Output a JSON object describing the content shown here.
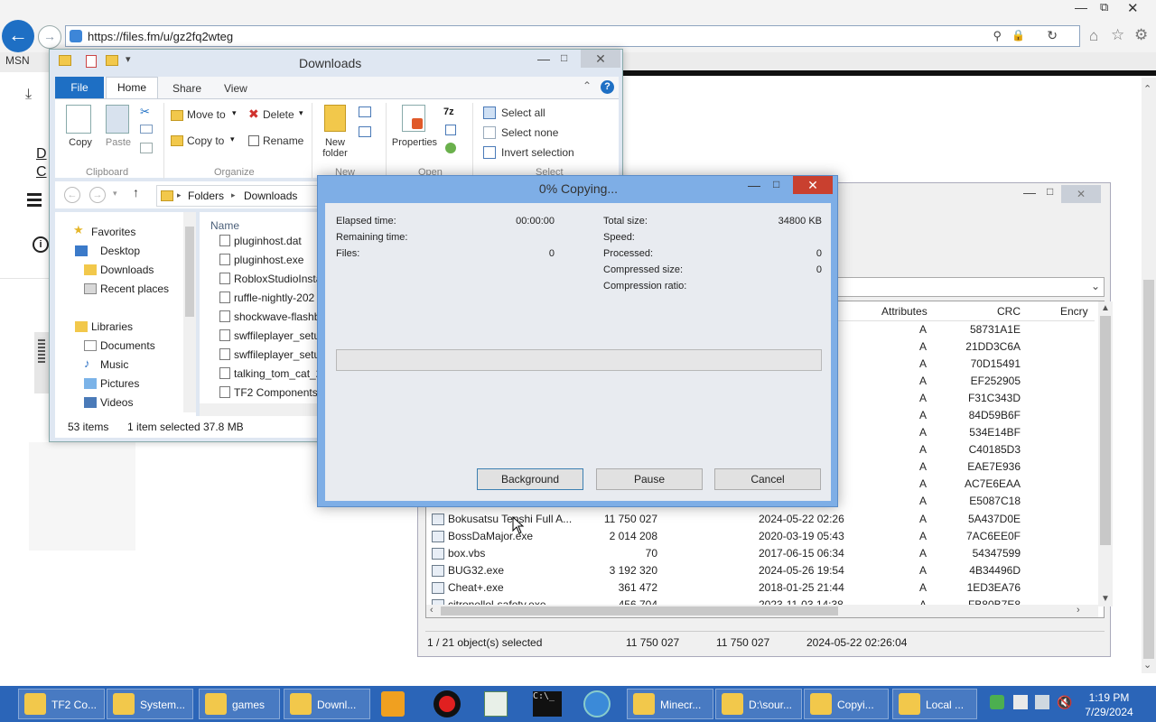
{
  "browser": {
    "url": "https://files.fm/u/gz2fq2wteg",
    "tab_label": "MSN"
  },
  "page": {
    "fragment_letters": [
      "D",
      "C"
    ]
  },
  "explorer": {
    "title": "Downloads",
    "tabs": [
      "File",
      "Home",
      "Share",
      "View"
    ],
    "ribbon": {
      "copy": "Copy",
      "paste": "Paste",
      "move_to": "Move to",
      "copy_to": "Copy to",
      "delete": "Delete",
      "rename": "Rename",
      "new_folder_1": "New",
      "new_folder_2": "folder",
      "properties": "Properties",
      "select_all": "Select all",
      "select_none": "Select none",
      "invert_selection": "Invert selection",
      "groups": {
        "clipboard": "Clipboard",
        "organize": "Organize",
        "new": "New",
        "open": "Open",
        "select": "Select"
      }
    },
    "breadcrumb": [
      "Folders",
      "Downloads"
    ],
    "tree": {
      "favorites": "Favorites",
      "desktop": "Desktop",
      "downloads": "Downloads",
      "recent": "Recent places",
      "libraries": "Libraries",
      "documents": "Documents",
      "music": "Music",
      "pictures": "Pictures",
      "videos": "Videos"
    },
    "column_name": "Name",
    "files": [
      "pluginhost.dat",
      "pluginhost.exe",
      "RobloxStudioInsta",
      "ruffle-nightly-202",
      "shockwave-flashb",
      "swffileplayer_setu",
      "swffileplayer_setu",
      "talking_tom_cat_2",
      "TF2 Components."
    ],
    "status": {
      "items": "53 items",
      "selected": "1 item selected",
      "size": "37.8 MB"
    }
  },
  "archive_window": {
    "columns": {
      "attributes": "Attributes",
      "crc": "CRC",
      "encrypted": "Encry"
    },
    "rows_hidden": [
      {
        "attr": "A",
        "crc": "58731A1E"
      },
      {
        "attr": "A",
        "crc": "21DD3C6A"
      },
      {
        "attr": "A",
        "crc": "70D15491"
      },
      {
        "attr": "A",
        "crc": "EF252905"
      },
      {
        "attr": "A",
        "crc": "F31C343D"
      },
      {
        "attr": "A",
        "crc": "84D59B6F"
      },
      {
        "attr": "A",
        "crc": "534E14BF"
      },
      {
        "attr": "A",
        "crc": "C40185D3"
      },
      {
        "attr": "A",
        "crc": "EAE7E936"
      },
      {
        "attr": "A",
        "crc": "AC7E6EAA"
      },
      {
        "attr": "A",
        "crc": "E5087C18"
      }
    ],
    "rows": [
      {
        "name": "Bokusatsu Tenshi Full A...",
        "size": "11 750 027",
        "date": "2024-05-22 02:26",
        "attr": "A",
        "crc": "5A437D0E"
      },
      {
        "name": "BossDaMajor.exe",
        "size": "2 014 208",
        "date": "2020-03-19 05:43",
        "attr": "A",
        "crc": "7AC6EE0F"
      },
      {
        "name": "box.vbs",
        "size": "70",
        "date": "2017-06-15 06:34",
        "attr": "A",
        "crc": "54347599"
      },
      {
        "name": "BUG32.exe",
        "size": "3 192 320",
        "date": "2024-05-26 19:54",
        "attr": "A",
        "crc": "4B34496D"
      },
      {
        "name": "Cheat+.exe",
        "size": "361 472",
        "date": "2018-01-25 21:44",
        "attr": "A",
        "crc": "1ED3EA76"
      },
      {
        "name": "citronellol-safety.exe",
        "size": "456 704",
        "date": "2023-11-03 14:38",
        "attr": "A",
        "crc": "FB80B7E8"
      }
    ],
    "status": {
      "selected": "1 / 21 object(s) selected",
      "size1": "11 750 027",
      "size2": "11 750 027",
      "date": "2024-05-22 02:26:04"
    }
  },
  "copy_dialog": {
    "title": "0% Copying...",
    "progress_percent": 0,
    "labels": {
      "elapsed": "Elapsed time:",
      "remaining": "Remaining time:",
      "files": "Files:",
      "total_size": "Total size:",
      "speed": "Speed:",
      "processed": "Processed:",
      "compressed": "Compressed size:",
      "ratio": "Compression ratio:"
    },
    "values": {
      "elapsed": "00:00:00",
      "files": "0",
      "total_size": "34800 KB",
      "processed": "0",
      "compressed": "0"
    },
    "buttons": {
      "background": "Background",
      "pause": "Pause",
      "cancel": "Cancel"
    }
  },
  "taskbar": {
    "items": [
      {
        "label": "TF2 Co...",
        "icon": "ie-icon"
      },
      {
        "label": "System...",
        "icon": "folder-icon"
      },
      {
        "label": "games",
        "icon": "folder-icon"
      },
      {
        "label": "Downl...",
        "icon": "folder-icon"
      },
      {
        "label": "Minecr...",
        "icon": "minecraft-icon"
      },
      {
        "label": "D:\\sour...",
        "icon": "7zip-icon"
      },
      {
        "label": "Copyi...",
        "icon": "7zip-icon"
      },
      {
        "label": "Local ...",
        "icon": "notepad-icon"
      }
    ],
    "clock_time": "1:19 PM",
    "clock_date": "7/29/2024"
  },
  "colors": {
    "accent": "#1e6fc4",
    "taskbar": "#2b65b8",
    "dialog_frame": "#7eaee6",
    "close_red": "#c9402f"
  }
}
